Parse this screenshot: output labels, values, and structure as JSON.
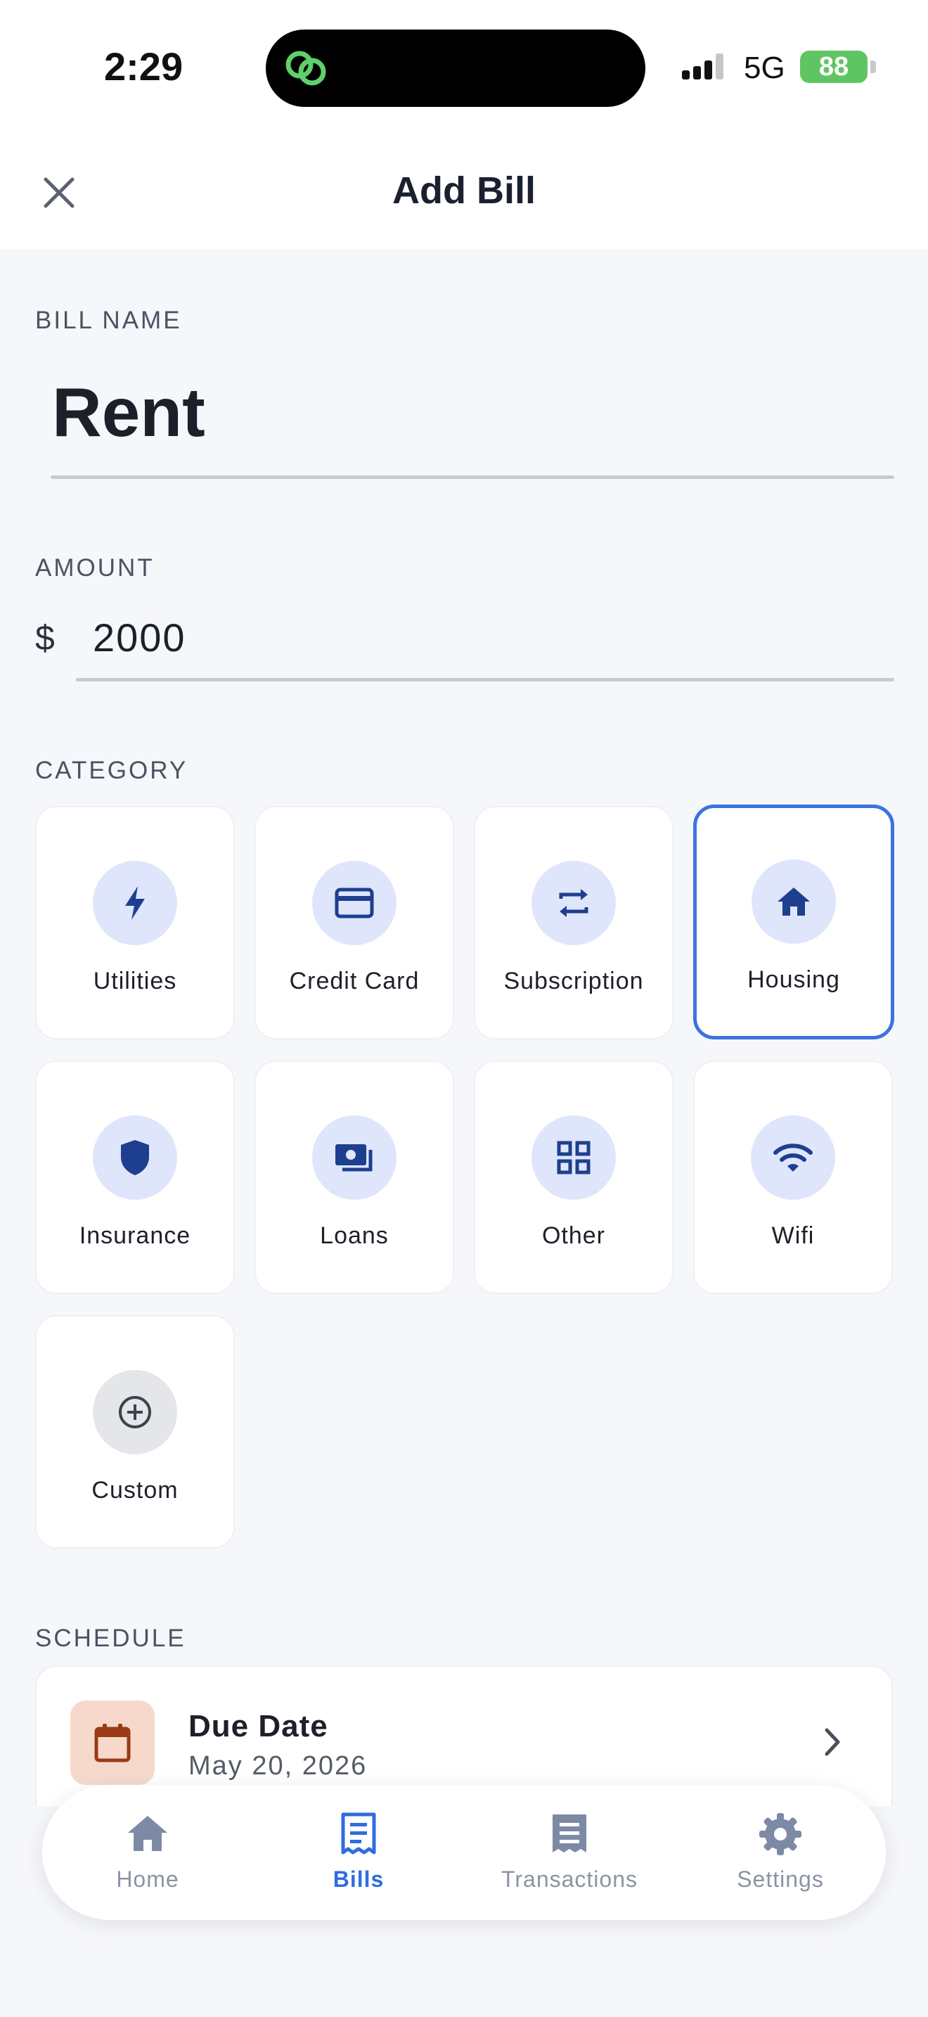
{
  "status_bar": {
    "time": "2:29",
    "network": "5G",
    "battery": "88"
  },
  "header": {
    "title": "Add Bill",
    "close_icon": "close-icon"
  },
  "bill_name": {
    "label": "BILL NAME",
    "value": "Rent"
  },
  "amount": {
    "label": "AMOUNT",
    "currency": "$",
    "value": "2000"
  },
  "category": {
    "label": "CATEGORY",
    "selected": "Housing",
    "items": [
      {
        "label": "Utilities",
        "icon": "bolt-icon"
      },
      {
        "label": "Credit Card",
        "icon": "credit-card-icon"
      },
      {
        "label": "Subscription",
        "icon": "repeat-icon"
      },
      {
        "label": "Housing",
        "icon": "home-icon"
      },
      {
        "label": "Insurance",
        "icon": "shield-icon"
      },
      {
        "label": "Loans",
        "icon": "money-icon"
      },
      {
        "label": "Other",
        "icon": "grid-icon"
      },
      {
        "label": "Wifi",
        "icon": "wifi-icon"
      },
      {
        "label": "Custom",
        "icon": "add-circle-icon"
      }
    ]
  },
  "schedule": {
    "label": "SCHEDULE",
    "due_title": "Due Date",
    "due_value": "May 20, 2026"
  },
  "nav": {
    "active": "Bills",
    "items": [
      {
        "label": "Home",
        "icon": "home-icon"
      },
      {
        "label": "Bills",
        "icon": "receipt-icon"
      },
      {
        "label": "Transactions",
        "icon": "list-icon"
      },
      {
        "label": "Settings",
        "icon": "gear-icon"
      }
    ]
  },
  "colors": {
    "accent": "#3a74e0",
    "icon_dark": "#1e3f8f",
    "icon_bg": "#dfe6fb",
    "due_icon_bg": "#f7d9cc",
    "due_icon": "#9a3b16",
    "battery": "#5fc562"
  }
}
